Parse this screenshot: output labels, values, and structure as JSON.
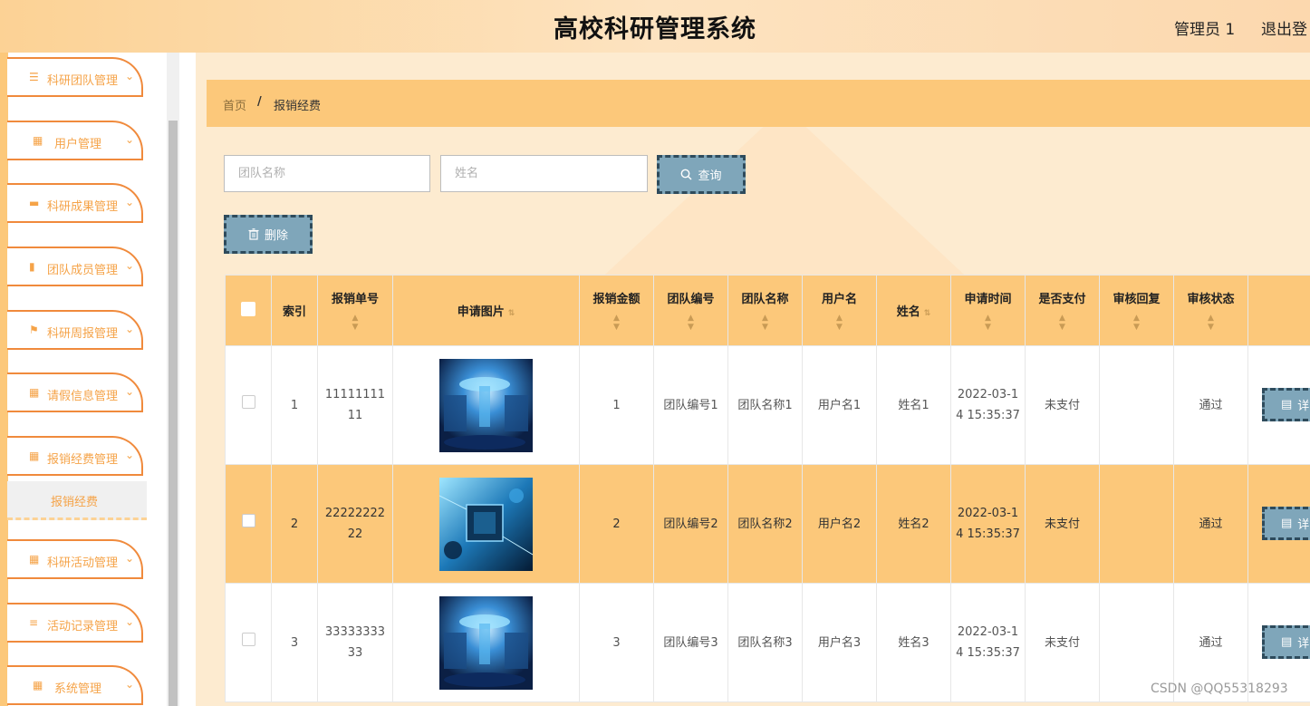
{
  "header": {
    "title": "高校科研管理系统",
    "user": "管理员 1",
    "logout": "退出登"
  },
  "sidebar": {
    "items": [
      {
        "label": "科研团队管理",
        "icon": "sliders-icon"
      },
      {
        "label": "用户管理",
        "icon": "grid-icon"
      },
      {
        "label": "科研成果管理",
        "icon": "briefcase-icon"
      },
      {
        "label": "团队成员管理",
        "icon": "books-icon"
      },
      {
        "label": "科研周报管理",
        "icon": "flag-icon"
      },
      {
        "label": "请假信息管理",
        "icon": "grid-icon"
      },
      {
        "label": "报销经费管理",
        "icon": "grid-icon"
      },
      {
        "label": "科研活动管理",
        "icon": "grid-icon"
      },
      {
        "label": "活动记录管理",
        "icon": "list-icon"
      },
      {
        "label": "系统管理",
        "icon": "apps-icon"
      }
    ],
    "submenu_label": "报销经费"
  },
  "breadcrumb": {
    "home": "首页",
    "separator": "/",
    "current": "报销经费"
  },
  "search": {
    "team_placeholder": "团队名称",
    "name_placeholder": "姓名",
    "query_label": "查询",
    "delete_label": "删除"
  },
  "table": {
    "headers": [
      "索引",
      "报销单号",
      "申请图片",
      "报销金额",
      "团队编号",
      "团队名称",
      "用户名",
      "姓名",
      "申请时间",
      "是否支付",
      "审核回复",
      "审核状态"
    ],
    "rows": [
      {
        "index": "1",
        "order_no": "1111111111",
        "amount": "1",
        "team_no": "团队编号1",
        "team_name": "团队名称1",
        "username": "用户名1",
        "name": "姓名1",
        "time": "2022-03-14 15:35:37",
        "paid": "未支付",
        "reply": "",
        "status": "通过",
        "image": "lab-photo"
      },
      {
        "index": "2",
        "order_no": "2222222222",
        "amount": "2",
        "team_no": "团队编号2",
        "team_name": "团队名称2",
        "username": "用户名2",
        "name": "姓名2",
        "time": "2022-03-14 15:35:37",
        "paid": "未支付",
        "reply": "",
        "status": "通过",
        "image": "circuit-photo"
      },
      {
        "index": "3",
        "order_no": "3333333333",
        "amount": "3",
        "team_no": "团队编号3",
        "team_name": "团队名称3",
        "username": "用户名3",
        "name": "姓名3",
        "time": "2022-03-14 15:35:37",
        "paid": "未支付",
        "reply": "",
        "status": "通过",
        "image": "lab-photo"
      }
    ],
    "detail_label": "详"
  },
  "watermark": "CSDN @QQ55318293",
  "colors": {
    "accent": "#fcc87a",
    "button": "#7fa6ba",
    "menu_border": "#f08a3c",
    "menu_text": "#f5a348"
  }
}
